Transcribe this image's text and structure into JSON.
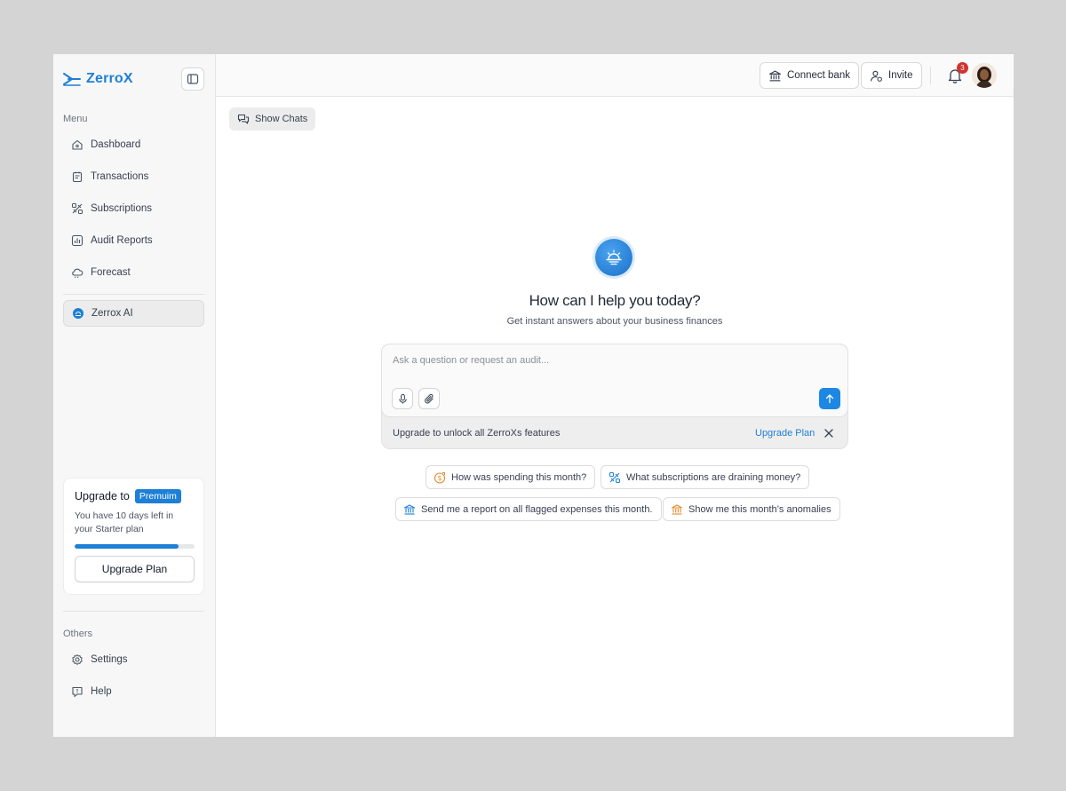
{
  "brand": {
    "name": "ZerroX"
  },
  "sidebar": {
    "menu_label": "Menu",
    "items": [
      {
        "label": "Dashboard",
        "icon": "home-icon"
      },
      {
        "label": "Transactions",
        "icon": "receipt-icon"
      },
      {
        "label": "Subscriptions",
        "icon": "subscriptions-icon"
      },
      {
        "label": "Audit Reports",
        "icon": "chart-icon"
      },
      {
        "label": "Forecast",
        "icon": "cloud-icon"
      }
    ],
    "ai_item": {
      "label": "Zerrox AI",
      "icon": "ai-icon"
    },
    "others_label": "Others",
    "others": [
      {
        "label": "Settings",
        "icon": "gear-icon"
      },
      {
        "label": "Help",
        "icon": "help-icon"
      }
    ]
  },
  "upgrade_card": {
    "title": "Upgrade to",
    "badge": "Premuim",
    "description": "You have 10 days left in your Starter plan",
    "progress": 0.87,
    "button": "Upgrade Plan"
  },
  "topbar": {
    "connect_bank": "Connect bank",
    "invite": "Invite",
    "notification_count": "3"
  },
  "main": {
    "show_chats": "Show Chats",
    "title": "How can I help you today?",
    "subtitle": "Get instant answers about your business finances",
    "input_placeholder": "Ask a question or request an audit...",
    "upgrade_note": "Upgrade to unlock all ZerroXs features",
    "upgrade_link": "Upgrade Plan",
    "suggestions": [
      {
        "label": "How was spending this month?",
        "icon": "dollar-icon"
      },
      {
        "label": "What subscriptions are draining money?",
        "icon": "subscriptions-icon"
      },
      {
        "label": "Send me a report on all flagged expenses this month.",
        "icon": "bank-icon"
      },
      {
        "label": "Show me this month’s anomalies",
        "icon": "bank-icon"
      }
    ]
  },
  "colors": {
    "accent": "#1d7fd6",
    "badge_red": "#d1342f",
    "orange_icon": "#e08a2c"
  }
}
